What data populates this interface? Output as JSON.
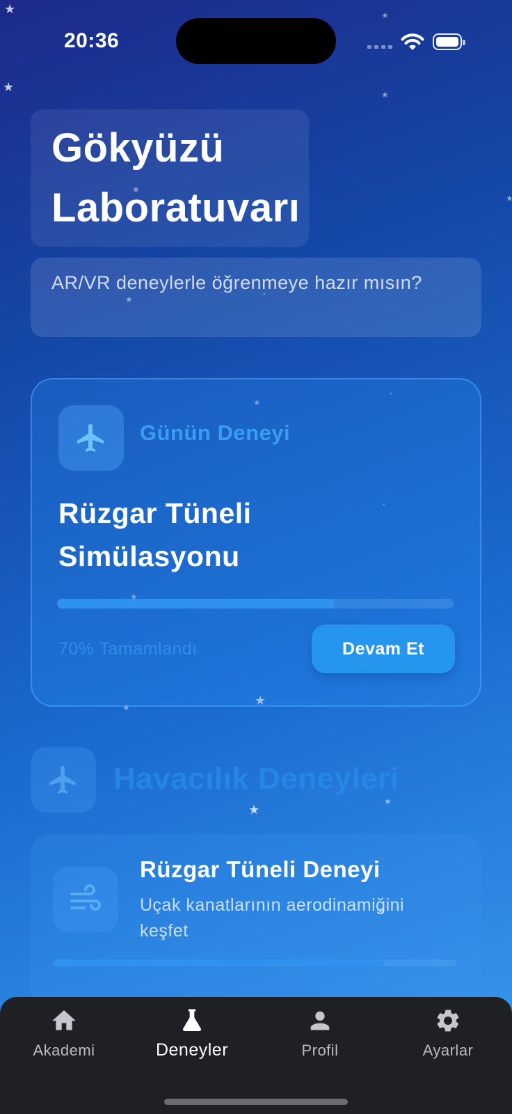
{
  "status_bar": {
    "time": "20:36"
  },
  "header": {
    "title": "Gökyüzü Laboratuvarı",
    "subtitle": "AR/VR deneylerle öğrenmeye hazır mısın?"
  },
  "featured": {
    "tag": "Günün Deneyi",
    "icon": "airplane-icon",
    "title": "Rüzgar Tüneli Simülasyonu",
    "progress": 0.7,
    "progress_text": "70% Tamamlandı",
    "button_label": "Devam Et"
  },
  "section": {
    "icon": "airplane-icon",
    "title": "Havacılık Deneyleri",
    "experiments": [
      {
        "icon": "wind-icon",
        "title": "Rüzgar Tüneli Deneyi",
        "description": "Uçak kanatlarının aerodinamiğini keşfet",
        "progress": 0.82
      }
    ]
  },
  "tab_bar": {
    "items": [
      {
        "label": "Akademi",
        "icon": "home-icon",
        "active": false
      },
      {
        "label": "Deneyler",
        "icon": "flask-icon",
        "active": true
      },
      {
        "label": "Profil",
        "icon": "person-icon",
        "active": false
      },
      {
        "label": "Ayarlar",
        "icon": "gear-icon",
        "active": false
      }
    ]
  },
  "colors": {
    "accent": "#2595ee",
    "tab_bar_bg": "#1f2024"
  }
}
